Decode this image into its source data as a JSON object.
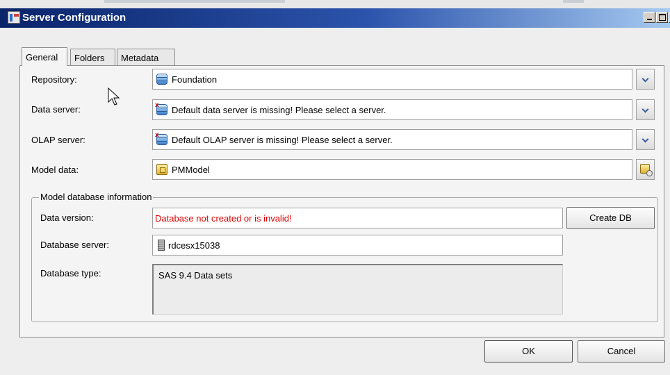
{
  "window": {
    "title": "Server Configuration"
  },
  "tabs": [
    {
      "label": "General",
      "active": true
    },
    {
      "label": "Folders",
      "active": false
    },
    {
      "label": "Metadata",
      "active": false
    }
  ],
  "general": {
    "repository": {
      "label": "Repository:",
      "value": "Foundation",
      "icon": "database-icon"
    },
    "data_server": {
      "label": "Data server:",
      "value": "Default data server is missing! Please select a server.",
      "icon": "database-error-icon"
    },
    "olap_server": {
      "label": "OLAP server:",
      "value": "Default OLAP server is missing! Please select a server.",
      "icon": "database-error-icon"
    },
    "model_data": {
      "label": "Model data:",
      "value": "PMModel",
      "icon": "model-icon"
    }
  },
  "model_db": {
    "legend": "Model database information",
    "data_version": {
      "label": "Data version:",
      "value": "Database not created or is invalid!",
      "color": "#e00000"
    },
    "create_db_label": "Create DB",
    "database_server": {
      "label": "Database server:",
      "value": "rdcesx15038",
      "icon": "server-icon"
    },
    "database_type": {
      "label": "Database type:",
      "value": "SAS 9.4 Data sets"
    }
  },
  "footer": {
    "ok_label": "OK",
    "cancel_label": "Cancel"
  }
}
